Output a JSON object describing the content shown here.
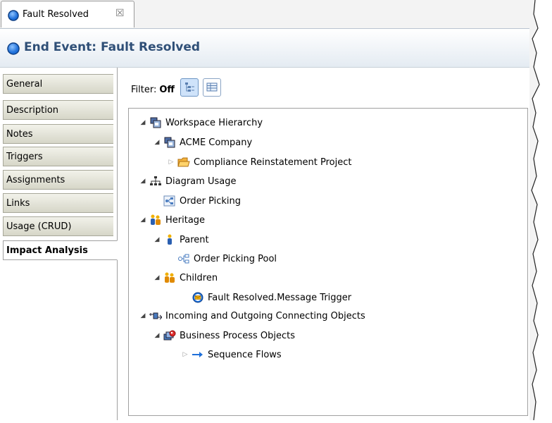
{
  "editor_tab": {
    "title": "Fault Resolved",
    "close_glyph": "☒"
  },
  "header": {
    "title": "End Event: Fault Resolved"
  },
  "side_tabs": [
    {
      "label": "General"
    },
    {
      "label": "Description"
    },
    {
      "label": "Notes"
    },
    {
      "label": "Triggers"
    },
    {
      "label": "Assignments"
    },
    {
      "label": "Links"
    },
    {
      "label": "Usage (CRUD)"
    },
    {
      "label": "Impact Analysis",
      "active": true
    }
  ],
  "filter": {
    "label": "Filter:",
    "value": "Off"
  },
  "toolbar": {
    "tree_view_icon": "tree-view-icon",
    "table_view_icon": "table-view-icon"
  },
  "tree": [
    {
      "label": "Workspace Hierarchy",
      "icon": "workspace-icon",
      "expanded": true
    },
    {
      "label": "ACME Company",
      "icon": "workspace-icon",
      "expanded": true
    },
    {
      "label": "Compliance Reinstatement Project",
      "icon": "folder-icon",
      "expanded": false
    },
    {
      "label": "Diagram Usage",
      "icon": "hierarchy-icon",
      "expanded": true
    },
    {
      "label": "Order Picking",
      "icon": "diagram-icon"
    },
    {
      "label": "Heritage",
      "icon": "people-icon",
      "expanded": true
    },
    {
      "label": "Parent",
      "icon": "person-icon",
      "expanded": true
    },
    {
      "label": "Order Picking Pool",
      "icon": "pool-icon"
    },
    {
      "label": "Children",
      "icon": "people-icon",
      "expanded": true
    },
    {
      "label": "Fault Resolved.Message Trigger",
      "icon": "message-trigger-icon"
    },
    {
      "label": "Incoming and Outgoing Connecting Objects",
      "icon": "connector-icon",
      "expanded": true
    },
    {
      "label": "Business Process Objects",
      "icon": "process-objects-icon",
      "expanded": true
    },
    {
      "label": "Sequence Flows",
      "icon": "arrow-right-icon",
      "expanded": false
    }
  ],
  "colors": {
    "header_title": "#2f4f77",
    "event_blue": "#1e6fd9",
    "selected_button": "#cfe3fa"
  }
}
